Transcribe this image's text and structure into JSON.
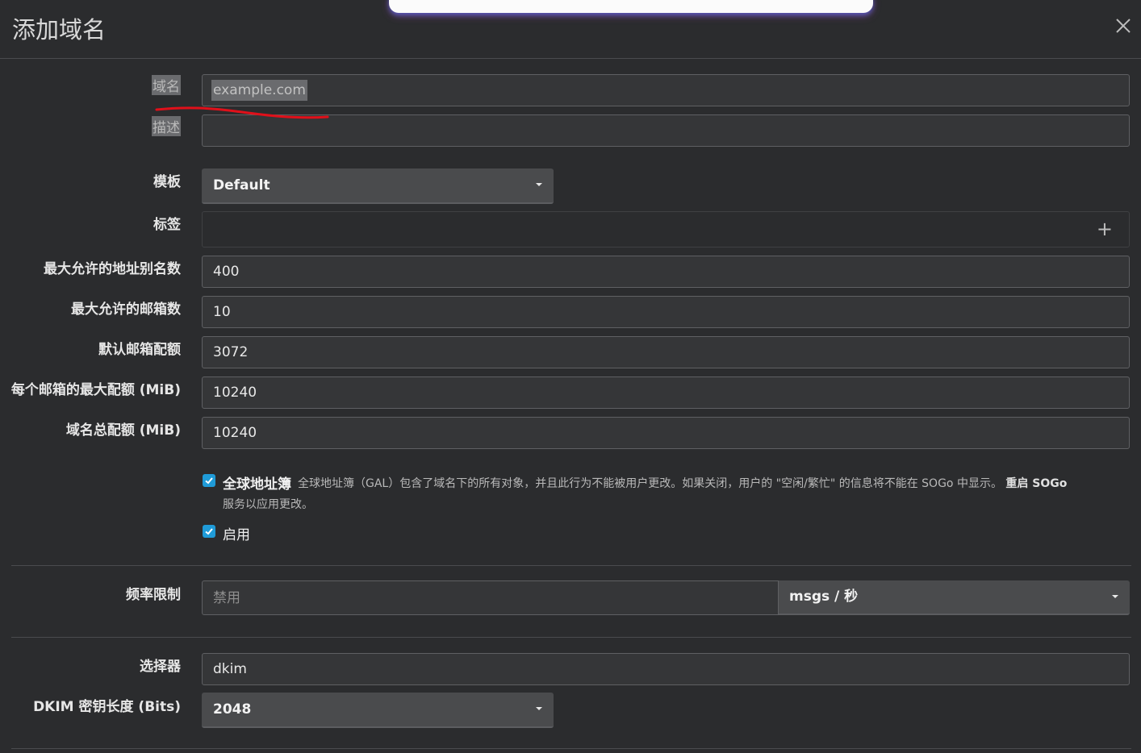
{
  "header": {
    "title": "添加域名",
    "close_label": "×"
  },
  "form": {
    "domain": {
      "label": "域名",
      "placeholder": "example.com",
      "value": ""
    },
    "description": {
      "label": "描述",
      "value": ""
    },
    "template": {
      "label": "模板",
      "selected": "Default"
    },
    "tags": {
      "label": "标签",
      "add_icon": "plus-icon"
    },
    "max_aliases": {
      "label": "最大允许的地址别名数",
      "value": "400"
    },
    "max_mailboxes": {
      "label": "最大允许的邮箱数",
      "value": "10"
    },
    "default_quota": {
      "label": "默认邮箱配额",
      "value": "3072"
    },
    "max_quota_per_mailbox": {
      "label": "每个邮箱的最大配额 (MiB)",
      "value": "10240"
    },
    "domain_total_quota": {
      "label": "域名总配额 (MiB)",
      "value": "10240"
    },
    "gal": {
      "title": "全球地址簿",
      "help_line1": "全球地址簿（GAL）包含了域名下的所有对象，并且此行为不能被用户更改。如果关闭，用户的 \"空闲/繁忙\" 的信息将不能在 SOGo 中显示。",
      "help_bold": "重启 SOGo",
      "help_line2": "服务以应用更改。",
      "checked": true
    },
    "active": {
      "label": "启用",
      "checked": true
    },
    "rate_limit": {
      "label": "频率限制",
      "placeholder": "禁用",
      "unit": "msgs / 秒"
    },
    "dkim_selector": {
      "label": "选择器",
      "value": "dkim"
    },
    "dkim_length": {
      "label": "DKIM 密钥长度 (Bits)",
      "selected": "2048"
    }
  },
  "colors": {
    "accent": "#1f9bd8",
    "annotation": "#e0101a",
    "background": "#2b2c2e"
  }
}
